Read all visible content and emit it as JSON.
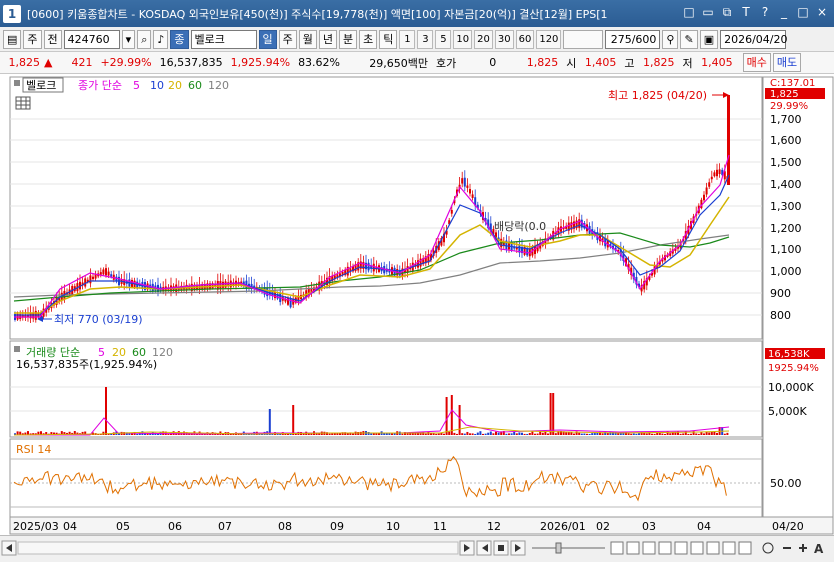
{
  "window": {
    "icon_label": "1",
    "title": "[0600] 키움종합차트 - KOSDAQ 외국인보유[450(천)] 주식수[19,778(천)] 액면[100] 자본금[20(억)] 결산[12월] EPS[1",
    "controls": [
      "□",
      "▭",
      "⧉",
      "T",
      "?",
      "_",
      "□",
      "×"
    ]
  },
  "toolbar": {
    "market": "주",
    "prev": "전",
    "code": "424760",
    "name_prefix": "종",
    "name": "벨로크",
    "periods": [
      "일",
      "주",
      "월",
      "년",
      "분",
      "초",
      "틱"
    ],
    "selected_period": "일",
    "intervals": [
      "1",
      "3",
      "5",
      "10",
      "20",
      "30",
      "60",
      "120"
    ],
    "count": "275/600",
    "date": "2026/04/20"
  },
  "quote": {
    "price": "1,825",
    "change": "421",
    "change_pct": "+29.99%",
    "volume": "16,537,835",
    "volume_pct": "1,925.94%",
    "turnover": "83.62%",
    "amount": "29,650백만",
    "bid_label": "호가",
    "bid": "0",
    "ask": "1,825",
    "open_label": "시",
    "open": "1,405",
    "high_label": "고",
    "high": "1,825",
    "low_label": "저",
    "low": "1,405",
    "buy_label": "매수",
    "sell_label": "매도"
  },
  "price_panel": {
    "stock_tag": "벨로크",
    "ma_label": "종가 단순",
    "ma_periods": [
      "5",
      "10",
      "20",
      "60",
      "120"
    ],
    "ma_colors": [
      "#1a3fd1",
      "#1a3fd1",
      "#d4b400",
      "#1a8a1a",
      "#808080"
    ],
    "high_annotation": "최고 1,825 (04/20)",
    "low_annotation": "최저 770 (03/19)",
    "event_annotation": "배당락(0.0",
    "top_value": "C:137.01",
    "current_price": "1,825",
    "current_pct": "29.99%",
    "y_ticks": [
      "1,700",
      "1,600",
      "1,500",
      "1,400",
      "1,300",
      "1,200",
      "1,100",
      "1,000",
      "900",
      "800"
    ]
  },
  "volume_panel": {
    "label": "거래량 단순",
    "ma_periods": [
      "5",
      "20",
      "60",
      "120"
    ],
    "ma_colors": [
      "#e000e0",
      "#d4b400",
      "#1a8a1a",
      "#808080"
    ],
    "current_line": "16,537,835주(1,925.94%)",
    "current_value": "16,538K",
    "current_pct": "1925.94%",
    "y_ticks": [
      "10,000K",
      "5,000K"
    ]
  },
  "rsi_panel": {
    "label": "RSI 14",
    "y_tick": "50.00"
  },
  "x_axis": {
    "labels": [
      "2025/03",
      "04",
      "05",
      "06",
      "07",
      "08",
      "09",
      "10",
      "11",
      "12",
      "2026/01",
      "02",
      "03",
      "04"
    ],
    "right_label": "04/20"
  },
  "colors": {
    "up": "#e00000",
    "down": "#1a3fd1",
    "rsi": "#e07000",
    "accent": "#3b6fb6"
  }
}
